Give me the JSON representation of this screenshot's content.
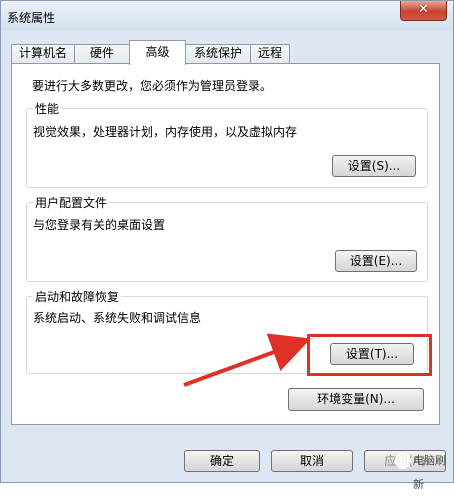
{
  "window": {
    "title": "系统属性",
    "close_glyph": "✕"
  },
  "tabs": [
    {
      "label": "计算机名",
      "active": false
    },
    {
      "label": "硬件",
      "active": false
    },
    {
      "label": "高级",
      "active": true
    },
    {
      "label": "系统保护",
      "active": false
    },
    {
      "label": "远程",
      "active": false
    }
  ],
  "notice": "要进行大多数更改，您必须作为管理员登录。",
  "groups": {
    "performance": {
      "title": "性能",
      "desc": "视觉效果，处理器计划，内存使用，以及虚拟内存",
      "button": "设置(S)..."
    },
    "user_profiles": {
      "title": "用户配置文件",
      "desc": "与您登录有关的桌面设置",
      "button": "设置(E)..."
    },
    "startup": {
      "title": "启动和故障恢复",
      "desc": "系统启动、系统失败和调试信息",
      "button": "设置(T)..."
    }
  },
  "env_button": "环境变量(N)...",
  "footer": {
    "ok": "确定",
    "cancel": "取消",
    "apply": "应用(A)"
  },
  "watermark": "电脑刷新",
  "colors": {
    "highlight": "#e03127",
    "window_bg": "#dce7f3"
  }
}
